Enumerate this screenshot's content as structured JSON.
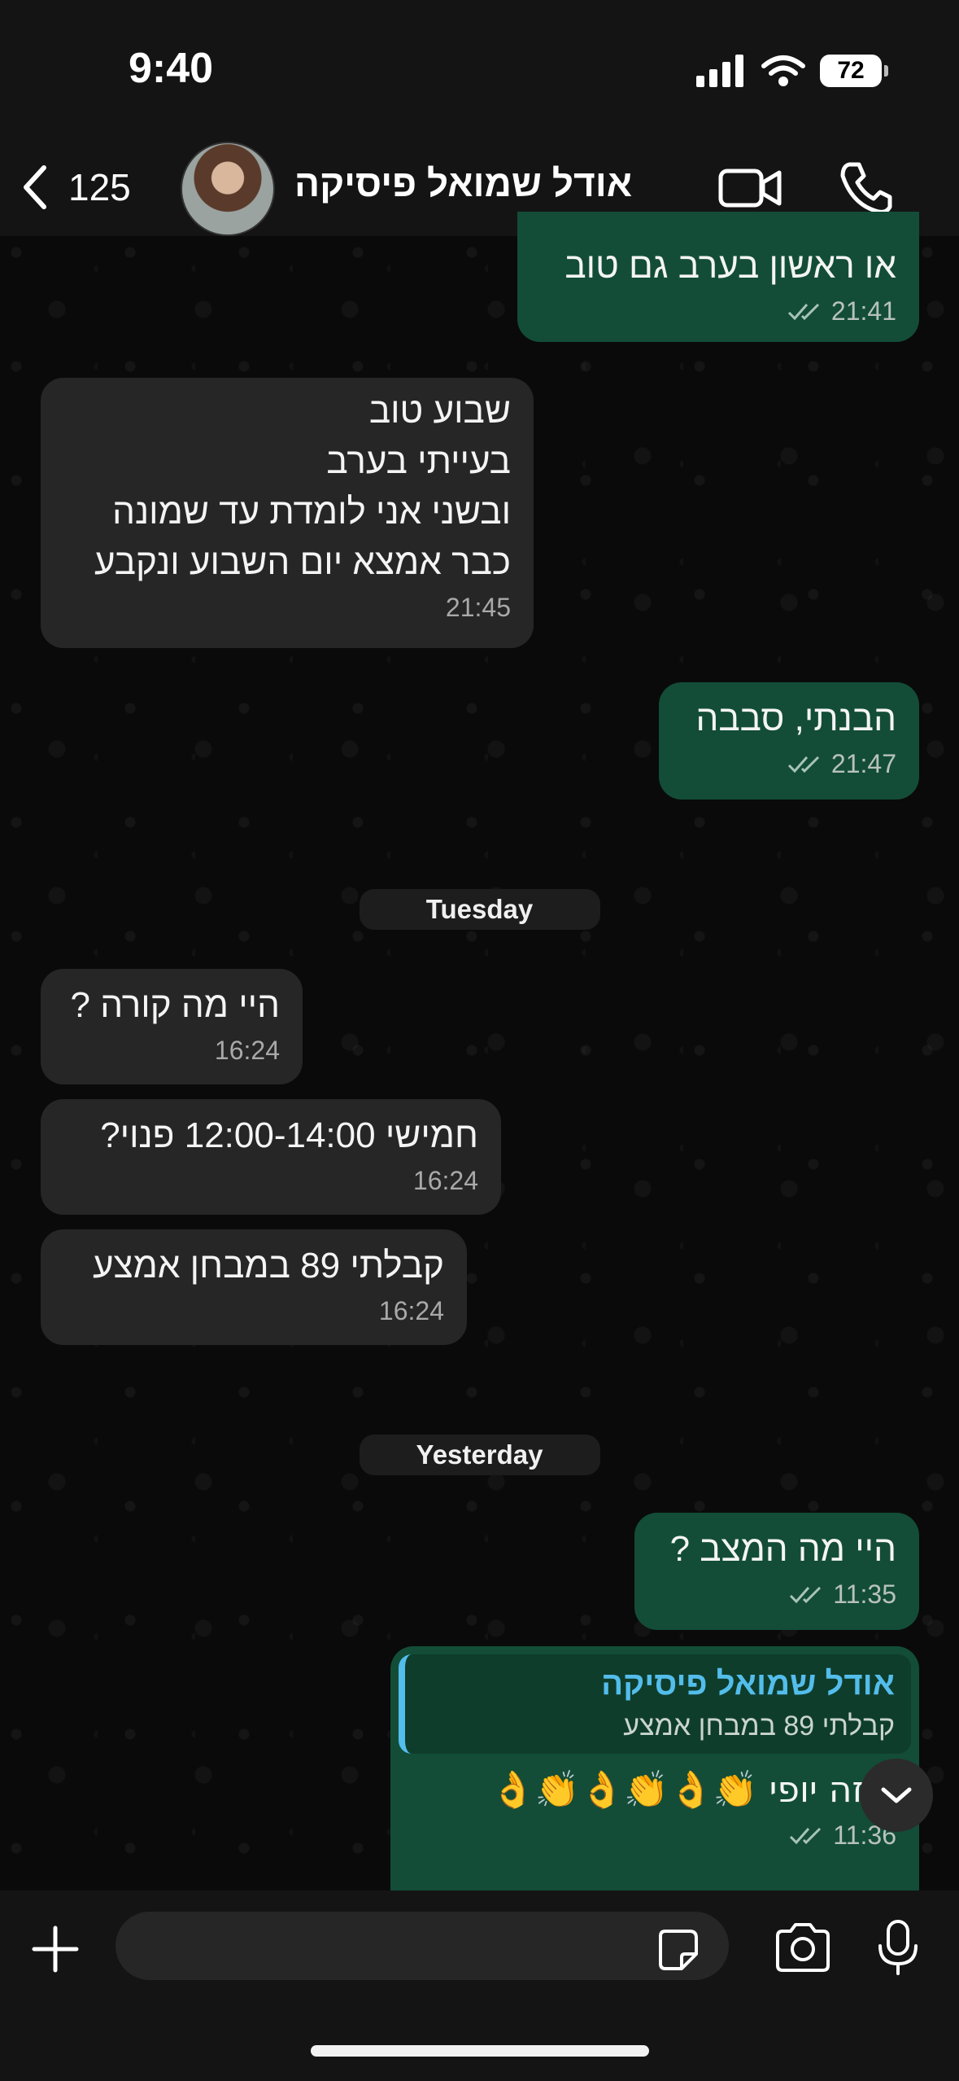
{
  "status_bar": {
    "time": "9:40",
    "battery": "72"
  },
  "header": {
    "back_count": "125",
    "contact_name": "אודל שמואל  פיסיקה"
  },
  "messages": [
    {
      "dir": "out",
      "text": "או ראשון בערב גם טוב",
      "time": "21:41"
    },
    {
      "dir": "in",
      "text": "שבוע טוב\nבעייתי בערב\nובשני אני לומדת עד שמונה\nכבר אמצא יום השבוע ונקבע",
      "time": "21:45"
    },
    {
      "dir": "out",
      "text": "הבנתי, סבבה",
      "time": "21:47"
    },
    {
      "dir": "in",
      "text": "היי מה קורה ?",
      "time": "16:24"
    },
    {
      "dir": "in",
      "text": "חמישי 12:00-14:00 פנוי?",
      "time": "16:24"
    },
    {
      "dir": "in",
      "text": "קבלתי 89 במבחן אמצע",
      "time": "16:24"
    },
    {
      "dir": "out",
      "text": "היי מה המצב ?",
      "time": "11:35"
    },
    {
      "dir": "out",
      "quote_name": "אודל שמואל  פיסיקה",
      "quote_text": "קבלתי 89 במבחן אמצע",
      "text": "איזה יופי 👏👌👏👌👏👌",
      "time": "11:36"
    }
  ],
  "date_separators": [
    "Tuesday",
    "Yesterday"
  ],
  "input": {
    "placeholder": ""
  },
  "icons": {
    "back": "chevron-left-icon",
    "video": "video-camera-icon",
    "phone": "phone-icon",
    "plus": "plus-icon",
    "sticker": "sticker-icon",
    "camera": "camera-icon",
    "mic": "microphone-icon",
    "scroll": "chevron-down-icon",
    "read": "double-check-icon"
  },
  "colors": {
    "incoming_bubble": "#262626",
    "outgoing_bubble": "#134d37",
    "quote_accent": "#53bdeb"
  }
}
